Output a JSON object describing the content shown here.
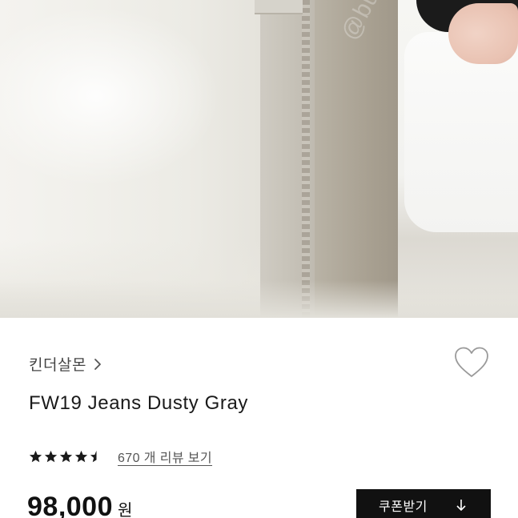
{
  "photo": {
    "alt": "product photo - gray jeans",
    "watermark": "@bungaejangter"
  },
  "product": {
    "brand": "킨더살몬",
    "title": "FW19 Jeans Dusty Gray",
    "rating": 4.5,
    "review_link": "670 개 리뷰 보기",
    "price": "98,000",
    "price_unit": "원",
    "wishlisted": false
  },
  "actions": {
    "coupon_label": "쿠폰받기"
  },
  "colors": {
    "text_primary": "#1a1a1a",
    "text_secondary": "#555555",
    "button_bg": "#111111",
    "button_text": "#ffffff",
    "heart_outline": "#9a9a9a"
  },
  "icons": {
    "brand_chevron": "chevron-right-icon",
    "wish": "heart-outline-icon",
    "star_full": "star-filled-icon",
    "star_half": "star-half-icon",
    "coupon": "arrow-down-icon"
  }
}
